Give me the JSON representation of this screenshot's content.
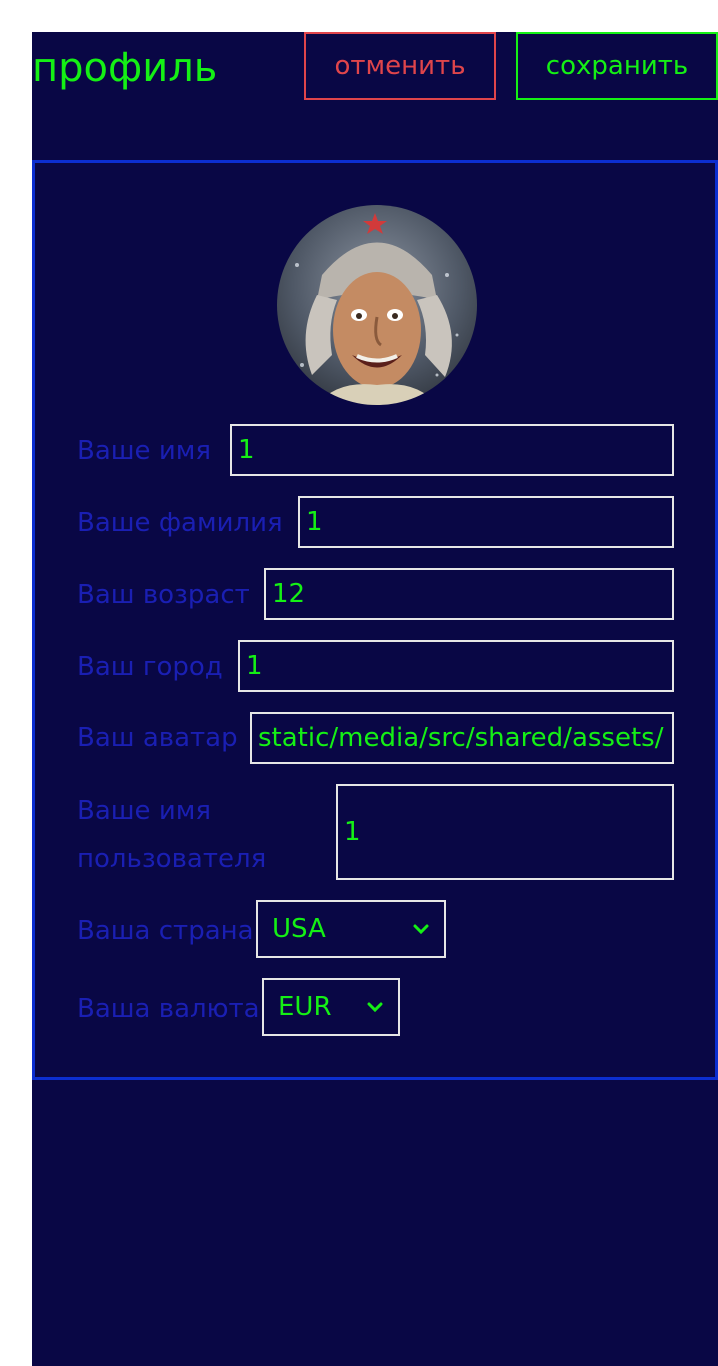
{
  "header": {
    "title": "профиль",
    "cancel_label": "отменить",
    "save_label": "сохранить"
  },
  "form": {
    "first_name": {
      "label": "Ваше имя",
      "value": "1"
    },
    "last_name": {
      "label": "Ваше фамилия",
      "value": "1"
    },
    "age": {
      "label": "Ваш возраст",
      "value": "12"
    },
    "city": {
      "label": "Ваш город",
      "value": "1"
    },
    "avatar_url": {
      "label": "Ваш аватар",
      "value": "static/media/src/shared/assets/"
    },
    "username": {
      "label": "Ваше имя пользователя",
      "value": "1"
    },
    "country": {
      "label": "Ваша страна",
      "selected": "USA"
    },
    "currency": {
      "label": "Ваша валюта",
      "selected": "EUR"
    }
  },
  "colors": {
    "background": "#090745",
    "accent_green": "#15f015",
    "cancel_red": "#e0454b",
    "card_border": "#0c2ed0",
    "label_blue": "#1a1fb3"
  },
  "icons": {
    "select_arrow": "chevron-down-icon"
  }
}
